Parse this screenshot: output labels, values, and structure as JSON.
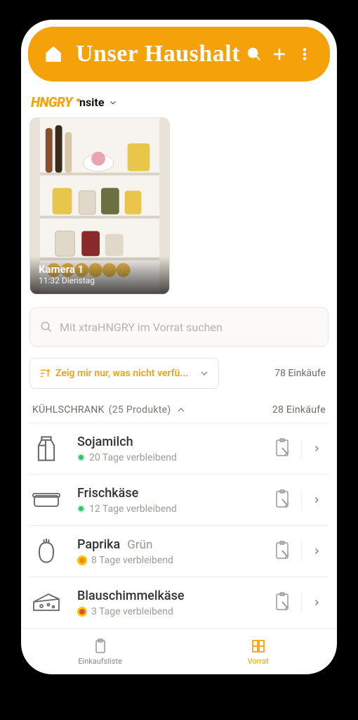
{
  "colors": {
    "accent": "#f5a20a"
  },
  "appbar": {
    "title": "Unser Haushalt"
  },
  "brand": {
    "prefix": "HNGRY",
    "suffix": "nsite"
  },
  "camera": {
    "name": "Kamera 1",
    "timestamp": "11:32 Dienstag"
  },
  "search": {
    "placeholder": "Mit xtraHNGRY im Vorrat suchen"
  },
  "filter": {
    "label": "Zeig mir nur, was nicht verfü..."
  },
  "totals": {
    "all_purchases": "78 Einkäufe"
  },
  "section": {
    "name": "KÜHLSCHRANK",
    "count": "(25 Produkte)",
    "purchases": "28 Einkäufe"
  },
  "items": [
    {
      "title": "Sojamilch",
      "variant": "",
      "remaining": "20 Tage verbleibend",
      "status": "green",
      "icon": "milk"
    },
    {
      "title": "Frischkäse",
      "variant": "",
      "remaining": "12 Tage verbleibend",
      "status": "green",
      "icon": "container"
    },
    {
      "title": "Paprika",
      "variant": "Grün",
      "remaining": "8 Tage verbleibend",
      "status": "yellow",
      "icon": "pepper"
    },
    {
      "title": "Blauschimmelkäse",
      "variant": "",
      "remaining": "3 Tage verbleibend",
      "status": "red",
      "icon": "cheese"
    }
  ],
  "bottomnav": {
    "shopping": "Einkaufsliste",
    "pantry": "Vorrat"
  }
}
